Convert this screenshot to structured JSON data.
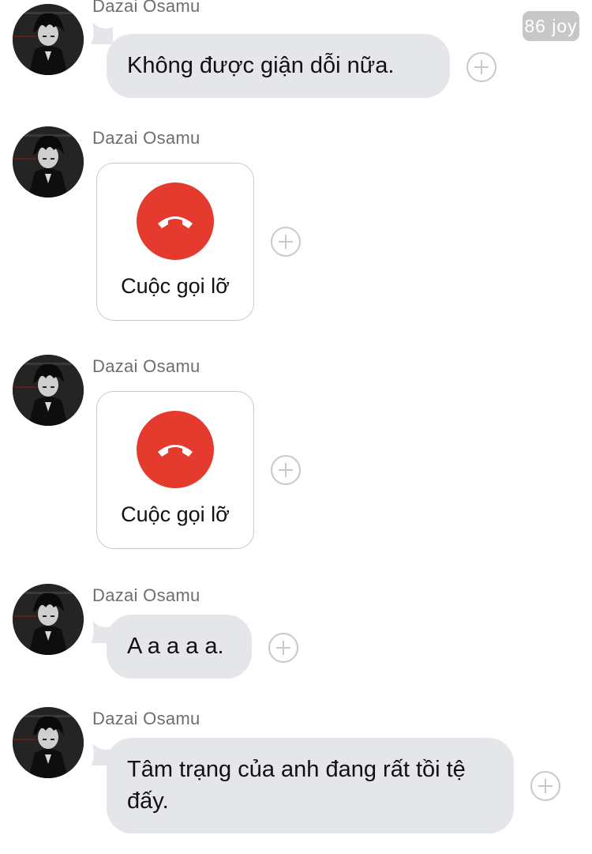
{
  "badge": {
    "text": "86 joy"
  },
  "messages": [
    {
      "sender": "Dazai Osamu",
      "type": "text",
      "text": "Không được giận dỗi nữa."
    },
    {
      "sender": "Dazai Osamu",
      "type": "call",
      "text": "Cuộc gọi lỡ"
    },
    {
      "sender": "Dazai Osamu",
      "type": "call",
      "text": "Cuộc gọi lỡ"
    },
    {
      "sender": "Dazai Osamu",
      "type": "text",
      "text": "A a a a a."
    },
    {
      "sender": "Dazai Osamu",
      "type": "text",
      "text": "Tâm trạng của anh đang rất tồi tệ đấy."
    }
  ],
  "icons": {
    "avatar": "avatar-dark-haired-character",
    "call": "phone-hangup-icon",
    "react": "plus-circle-icon"
  },
  "colors": {
    "bubble": "#e5e6ea",
    "missed_call": "#e53a2e",
    "sender_name": "#6d6d72",
    "badge": "#c7c7c9"
  }
}
